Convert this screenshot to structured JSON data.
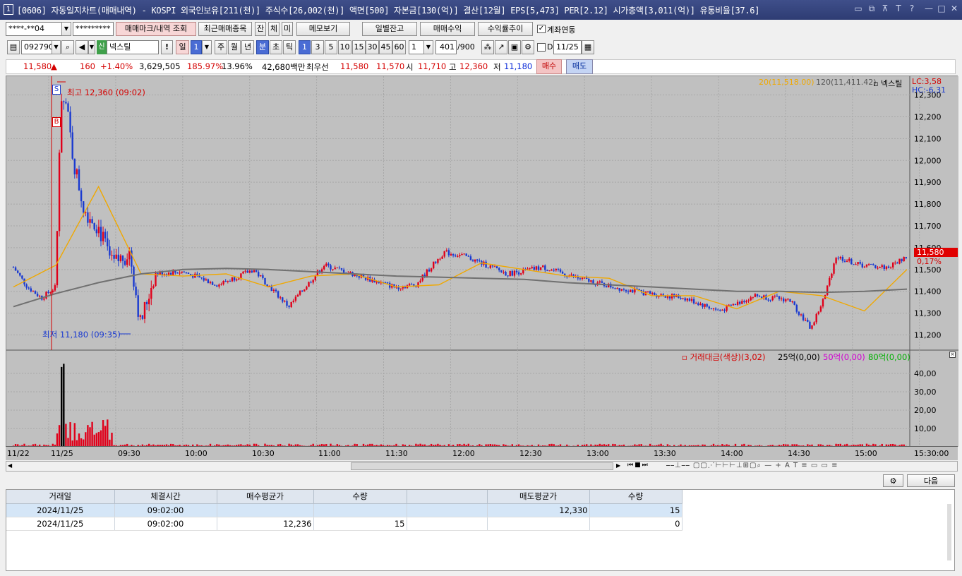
{
  "window": {
    "index": "1",
    "title": "[0606] 자동일지차트(매매내역) - KOSPI 외국인보유[211(천)] 주식수[26,002(천)] 액면[500] 자본금[130(억)] 결산[12월] EPS[5,473] PER[2.12] 시가총액[3,011(억)] 유통비율[37.6]",
    "controls": [
      "▭",
      "⧉",
      "⊼",
      "T",
      "?",
      "—",
      "□",
      "✕"
    ]
  },
  "toolbar1": {
    "account": "****-**04",
    "password": "*********",
    "btn_mark": "매매마크/내역 조회",
    "btn_recent": "최근매매종목",
    "btn_jan": "잔",
    "btn_che": "체",
    "btn_mi": "미",
    "btn_memo": "메모보기",
    "btn_daily": "일별잔고",
    "btn_profit": "매매수익",
    "btn_trend": "수익률추이",
    "chk_link": "계좌연동"
  },
  "toolbar2": {
    "code": "092790",
    "badge": "신",
    "name": "넥스틸",
    "excl": "!",
    "period_il": "일",
    "period_num": "1",
    "ju": "주",
    "wol": "월",
    "nyeon": "년",
    "bun": "분",
    "cho": "초",
    "tik": "틱",
    "intervals": [
      "1",
      "3",
      "5",
      "10",
      "15",
      "30",
      "45",
      "60"
    ],
    "sel_interval": "1",
    "count": "401",
    "count_max": "/900",
    "d_label": "D",
    "date": "11/25"
  },
  "quote": {
    "price": "11,580",
    "arrow": "▲",
    "change": "160",
    "rate": "+1.40%",
    "volume": "3,629,505",
    "vol_ratio": "185.97%",
    "turnover": "13.96%",
    "amount": "42,680백만",
    "best_label": "최우선",
    "ask": "11,580",
    "bid": "11,570",
    "open_label": "시",
    "open": "11,710",
    "high_label": "고",
    "high": "12,360",
    "low_label": "저",
    "low": "11,180",
    "buy_btn": "매수",
    "sell_btn": "매도"
  },
  "chart": {
    "legend_ma20": "20(11,518.00)",
    "legend_ma120": "120(11,411.42)",
    "legend_name": "▫ 넥스틸",
    "lc": "LC:3,58",
    "hc": "HC:-6,31",
    "high_mark": "최고 12,360 (09:02)",
    "low_mark": "최저 11,180 (09:35)",
    "mark_s": "S",
    "mark_b": "B",
    "cur_price_tag": "11,580",
    "cur_rate_tag": "0,17%",
    "vol_legend_1": "▫ 거래대금(색상)(3,02)",
    "vol_legend_2": "25억(0,00)",
    "vol_legend_3": "50억(0,00)",
    "vol_legend_4": "80억(0,00)",
    "price_ticks": [
      "12,300",
      "12,200",
      "12,100",
      "12,000",
      "11,900",
      "11,800",
      "11,700",
      "11,600",
      "11,500",
      "11,400",
      "11,300",
      "11,200"
    ],
    "vol_ticks": [
      "40,00",
      "30,00",
      "20,00",
      "10,00"
    ],
    "time_labels": [
      "11/22",
      "11/25",
      "09:30",
      "10:00",
      "10:30",
      "11:00",
      "11:30",
      "12:00",
      "12:30",
      "13:00",
      "13:30",
      "14:00",
      "14:30",
      "15:00",
      "15:30:00"
    ],
    "colors": {
      "up": "#e0001a",
      "down": "#1a3ad0",
      "ma20": "#f0a800",
      "ma120": "#707070",
      "bg": "#c0c0c0"
    }
  },
  "chart_data": {
    "type": "line",
    "title": "",
    "series": [
      {
        "name": "20",
        "values": [
          11420,
          11520,
          11880,
          11480,
          11470,
          11480,
          11420,
          11470,
          11480,
          11420,
          11430,
          11530,
          11500,
          11470,
          11460,
          11380,
          11380,
          11320,
          11400,
          11380,
          11310,
          11500
        ]
      },
      {
        "name": "120",
        "values": [
          11330,
          11390,
          11440,
          11480,
          11500,
          11505,
          11500,
          11490,
          11480,
          11470,
          11465,
          11460,
          11455,
          11440,
          11430,
          11420,
          11410,
          11400,
          11400,
          11395,
          11400,
          11410
        ]
      }
    ],
    "high": 12360,
    "low": 11180,
    "ylim": [
      11150,
      12360
    ]
  },
  "bottom": {
    "settings_icon": "gear-icon",
    "next_btn": "다음",
    "headers": [
      "거래일",
      "체결시간",
      "매수평균가",
      "수량",
      "",
      "매도평균가",
      "수량"
    ],
    "rows": [
      [
        "2024/11/25",
        "09:02:00",
        "",
        "",
        "",
        "12,330",
        "15"
      ],
      [
        "2024/11/25",
        "09:02:00",
        "12,236",
        "15",
        "",
        "",
        "0"
      ]
    ]
  }
}
